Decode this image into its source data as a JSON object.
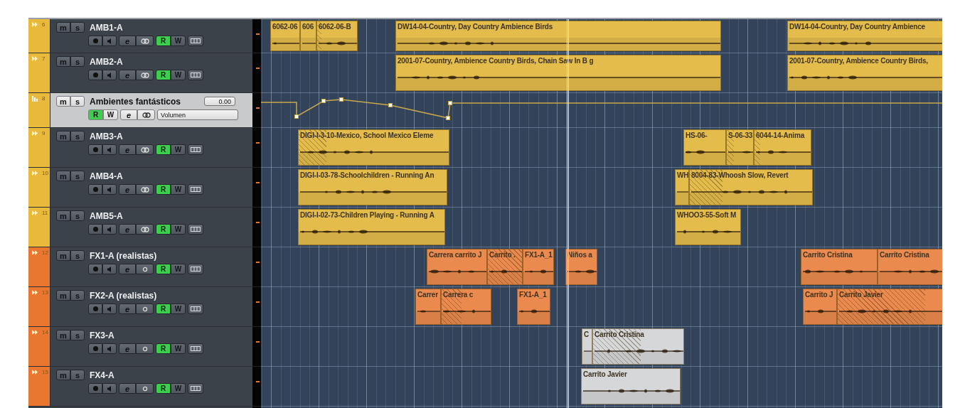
{
  "tracks": [
    {
      "number": "6",
      "name": "AMB1-A",
      "kind": "audio",
      "color": "#e9b93c",
      "stereo": true,
      "mute_label": "m",
      "solo_label": "s",
      "edit_label": "e",
      "read": {
        "label": "R",
        "on": true
      },
      "write": {
        "label": "W",
        "on": false
      },
      "events": [
        {
          "name": "6062-06",
          "fade": false,
          "color": "#e3bc4c"
        },
        {
          "name": "606",
          "fade": false,
          "color": "#e3bc4c"
        },
        {
          "name": "6062-06-B",
          "fade": true,
          "color": "#e3bc4c"
        },
        {
          "name": "DW14-04-Country, Day Country Ambience  Birds",
          "fade": false,
          "color": "#e3bc4c"
        },
        {
          "name": "DW14-04-Country, Day Country Ambience",
          "fade": false,
          "color": "#e3bc4c"
        }
      ]
    },
    {
      "number": "7",
      "name": "AMB2-A",
      "kind": "audio",
      "color": "#e9b93c",
      "stereo": true,
      "mute_label": "m",
      "solo_label": "s",
      "edit_label": "e",
      "read": {
        "label": "R",
        "on": true
      },
      "write": {
        "label": "W",
        "on": false
      },
      "events": [
        {
          "name": "2001-07-Country, Ambience Country  Birds, Chain Saw In B g",
          "fade": false,
          "color": "#e3bc4c"
        },
        {
          "name": "2001-07-Country, Ambience Country  Birds,",
          "fade": false,
          "color": "#e3bc4c"
        }
      ]
    },
    {
      "number": "8",
      "name": "Ambientes fantásticos",
      "kind": "automation",
      "color": "#e9b93c",
      "stereo": true,
      "mute_label": "m",
      "solo_label": "s",
      "edit_label": "e",
      "value": "0.00",
      "parameter": "Volumen",
      "read": {
        "label": "R",
        "on": true
      },
      "write": {
        "label": "W",
        "on": false
      }
    },
    {
      "number": "9",
      "name": "AMB3-A",
      "kind": "audio",
      "color": "#e9b93c",
      "stereo": true,
      "mute_label": "m",
      "solo_label": "s",
      "edit_label": "e",
      "read": {
        "label": "R",
        "on": true
      },
      "write": {
        "label": "W",
        "on": false
      },
      "events": [
        {
          "name": "DIGI-I-3-10-Mexico, School Mexico  Eleme",
          "fade": true,
          "color": "#e3bc4c"
        },
        {
          "name": "HS-06-",
          "fade": false,
          "color": "#e3bc4c"
        },
        {
          "name": "S-06-33",
          "fade": true,
          "color": "#e3bc4c"
        },
        {
          "name": "6044-14-Anima",
          "fade": true,
          "color": "#e3bc4c"
        }
      ]
    },
    {
      "number": "10",
      "name": "AMB4-A",
      "kind": "audio",
      "color": "#e9b93c",
      "stereo": true,
      "mute_label": "m",
      "solo_label": "s",
      "edit_label": "e",
      "read": {
        "label": "R",
        "on": true
      },
      "write": {
        "label": "W",
        "on": false
      },
      "events": [
        {
          "name": "DIGI-I-03-78-Schoolchildren - Running An",
          "fade": false,
          "color": "#e3bc4c"
        },
        {
          "name": "WH",
          "fade": false,
          "color": "#e3bc4c"
        },
        {
          "name": "8004-83-Whoosh Slow, Revert",
          "fade": true,
          "color": "#e3bc4c"
        }
      ]
    },
    {
      "number": "11",
      "name": "AMB5-A",
      "kind": "audio",
      "color": "#e9b93c",
      "stereo": true,
      "mute_label": "m",
      "solo_label": "s",
      "edit_label": "e",
      "read": {
        "label": "R",
        "on": true
      },
      "write": {
        "label": "W",
        "on": false
      },
      "events": [
        {
          "name": "DIGI-I-02-73-Children Playing - Running A",
          "fade": false,
          "color": "#e3bc4c"
        },
        {
          "name": "WHOO3-55-Soft M",
          "fade": false,
          "color": "#e3bc4c"
        }
      ]
    },
    {
      "number": "12",
      "name": "FX1-A (realistas)",
      "kind": "audio",
      "color": "#e9772f",
      "stereo": false,
      "mute_label": "m",
      "solo_label": "s",
      "edit_label": "e",
      "read": {
        "label": "R",
        "on": true
      },
      "write": {
        "label": "W",
        "on": false
      },
      "events": [
        {
          "name": "Carrera carrito J",
          "fade": false,
          "color": "#ea8a4e"
        },
        {
          "name": "Carrito .",
          "fade": true,
          "color": "#ea8a4e"
        },
        {
          "name": "FX1-A_1",
          "fade": false,
          "color": "#ea8a4e"
        },
        {
          "name": "Niños a",
          "fade": false,
          "color": "#ea8a4e"
        },
        {
          "name": "Carrito Cristina",
          "fade": false,
          "color": "#ea8a4e"
        },
        {
          "name": "Carrito Cristina",
          "fade": false,
          "color": "#ea8a4e"
        }
      ]
    },
    {
      "number": "13",
      "name": "FX2-A (realistas)",
      "kind": "audio",
      "color": "#e9772f",
      "stereo": false,
      "mute_label": "m",
      "solo_label": "s",
      "edit_label": "e",
      "read": {
        "label": "R",
        "on": true
      },
      "write": {
        "label": "W",
        "on": false
      },
      "events": [
        {
          "name": "Carrer",
          "fade": false,
          "color": "#ea8a4e"
        },
        {
          "name": "Carrera c",
          "fade": true,
          "color": "#ea8a4e"
        },
        {
          "name": "FX1-A_1",
          "fade": false,
          "color": "#ea8a4e"
        },
        {
          "name": "Carrito J",
          "fade": false,
          "color": "#ea8a4e"
        },
        {
          "name": "Carrito Javier",
          "fade": true,
          "color": "#ea8a4e"
        }
      ]
    },
    {
      "number": "14",
      "name": "FX3-A",
      "kind": "audio",
      "color": "#e9772f",
      "stereo": false,
      "mute_label": "m",
      "solo_label": "s",
      "edit_label": "e",
      "read": {
        "label": "R",
        "on": true
      },
      "write": {
        "label": "W",
        "on": false
      },
      "events": [
        {
          "name": "C",
          "fade": false,
          "color": "#d6d7d9"
        },
        {
          "name": "Carrito Cristina",
          "fade": true,
          "color": "#d6d7d9"
        }
      ]
    },
    {
      "number": "15",
      "name": "FX4-A",
      "kind": "audio",
      "color": "#e9772f",
      "stereo": false,
      "mute_label": "m",
      "solo_label": "s",
      "edit_label": "e",
      "read": {
        "label": "R",
        "on": true
      },
      "write": {
        "label": "W",
        "on": false
      },
      "events": [
        {
          "name": "Carrito Javier",
          "fade": false,
          "color": "#d6d7d9"
        }
      ]
    }
  ]
}
